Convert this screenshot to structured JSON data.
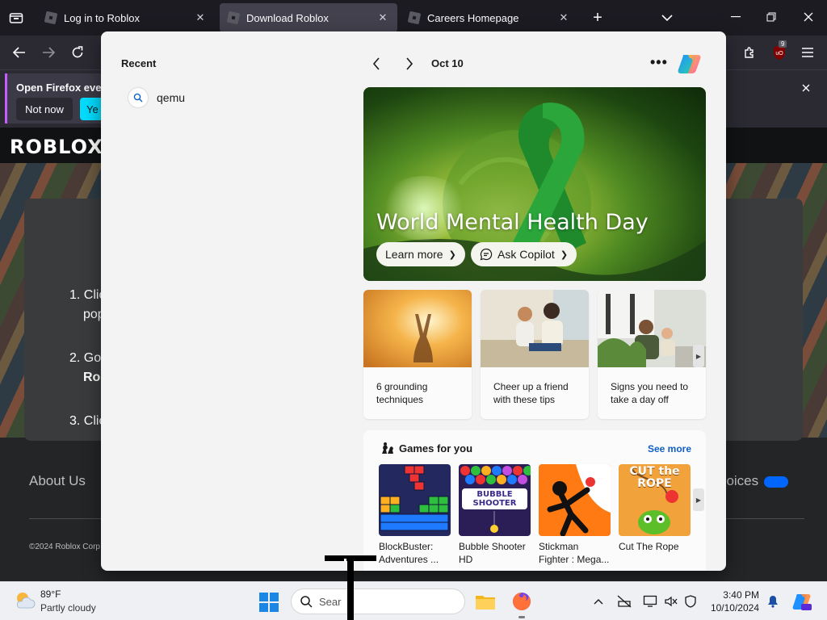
{
  "browser": {
    "tabs": [
      {
        "title": "Log in to Roblox",
        "active": false
      },
      {
        "title": "Download Roblox",
        "active": true
      },
      {
        "title": "Careers Homepage",
        "active": false
      }
    ],
    "extension_badge": "9"
  },
  "notification": {
    "text": "Open Firefox ever",
    "not_now": "Not now",
    "yes": "Ye"
  },
  "roblox": {
    "logo": "ROBLOX",
    "steps": [
      {
        "num": "1.",
        "line1": "Clic",
        "line2": "pop"
      },
      {
        "num": "2.",
        "line1": "Go",
        "line2": "Rob"
      },
      {
        "num": "3.",
        "line1": "Clic"
      }
    ],
    "footer_link": "About Us",
    "footer_right": "hoices",
    "copyright": "©2024 Roblox Corp"
  },
  "search_panel": {
    "recent_title": "Recent",
    "recent_items": [
      "qemu"
    ],
    "date": "Oct 10",
    "more": "•••",
    "hero": {
      "title": "World Mental Health Day",
      "learn_more": "Learn more",
      "ask_copilot": "Ask Copilot"
    },
    "cards": [
      {
        "text": "6 grounding techniques"
      },
      {
        "text": "Cheer up a friend with these tips"
      },
      {
        "text": "Signs you need to take a day off"
      }
    ],
    "games": {
      "title": "Games for you",
      "see_more": "See more",
      "items": [
        {
          "name": "BlockBuster: Adventures ..."
        },
        {
          "name": "Bubble Shooter HD",
          "art_text": "BUBBLE SHOOTER"
        },
        {
          "name": "Stickman Fighter : Mega..."
        },
        {
          "name": "Cut The Rope",
          "art_text": "CUT the ROPE"
        }
      ]
    }
  },
  "taskbar": {
    "temperature": "89°F",
    "condition": "Partly cloudy",
    "search_placeholder": "Sear",
    "time": "3:40 PM",
    "date": "10/10/2024"
  }
}
